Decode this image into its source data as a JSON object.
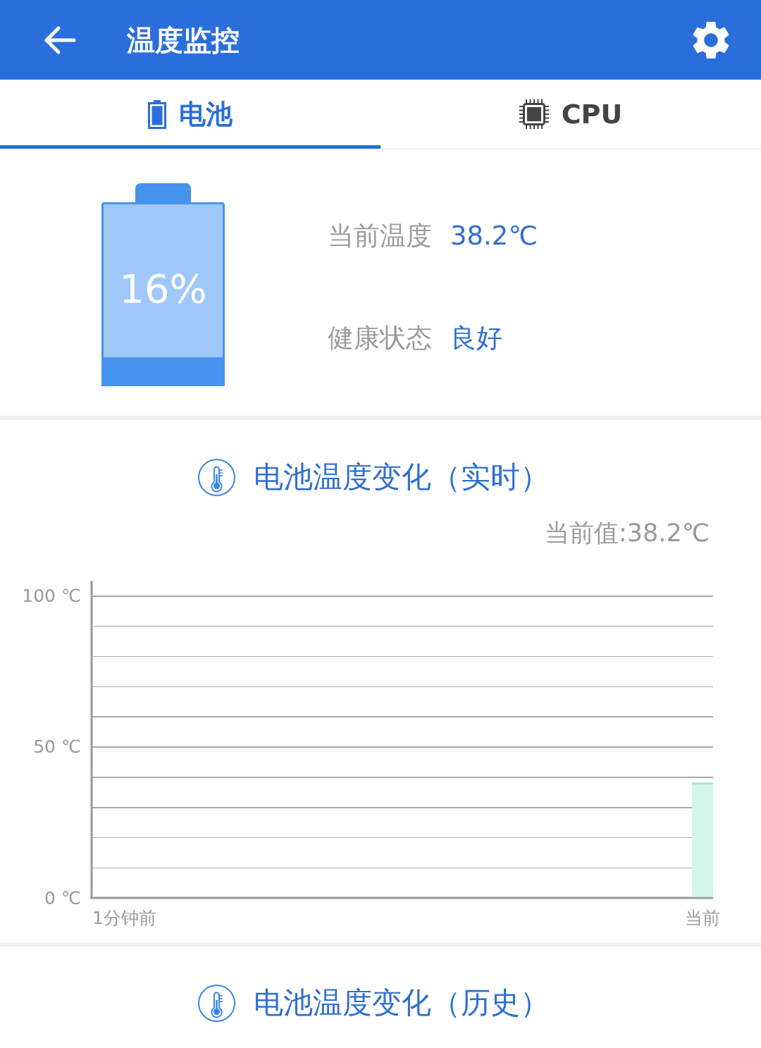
{
  "app_bar": {
    "title": "温度监控"
  },
  "tabs": [
    {
      "label": "电池",
      "kind": "battery",
      "selected": true
    },
    {
      "label": "CPU",
      "kind": "cpu",
      "selected": false
    }
  ],
  "battery": {
    "level": 0.16,
    "percent": "16%",
    "stats": [
      {
        "label": "当前温度",
        "value": "38.2℃"
      },
      {
        "label": "健康状态",
        "value": "良好"
      }
    ]
  },
  "realtime": {
    "title": "电池温度变化（实时）",
    "current_value": "当前值:38.2℃",
    "chart_data": {
      "type": "bar",
      "categories": [
        "1分钟前",
        "当前"
      ],
      "values": [
        null,
        38.2
      ],
      "ylim": [
        0,
        105
      ],
      "yticks": [
        {
          "value": 0,
          "label": "0 ℃"
        },
        {
          "value": 50,
          "label": "50 ℃"
        },
        {
          "value": 100,
          "label": "100 ℃"
        }
      ]
    }
  },
  "history": {
    "title": "电池温度变化（历史）"
  }
}
